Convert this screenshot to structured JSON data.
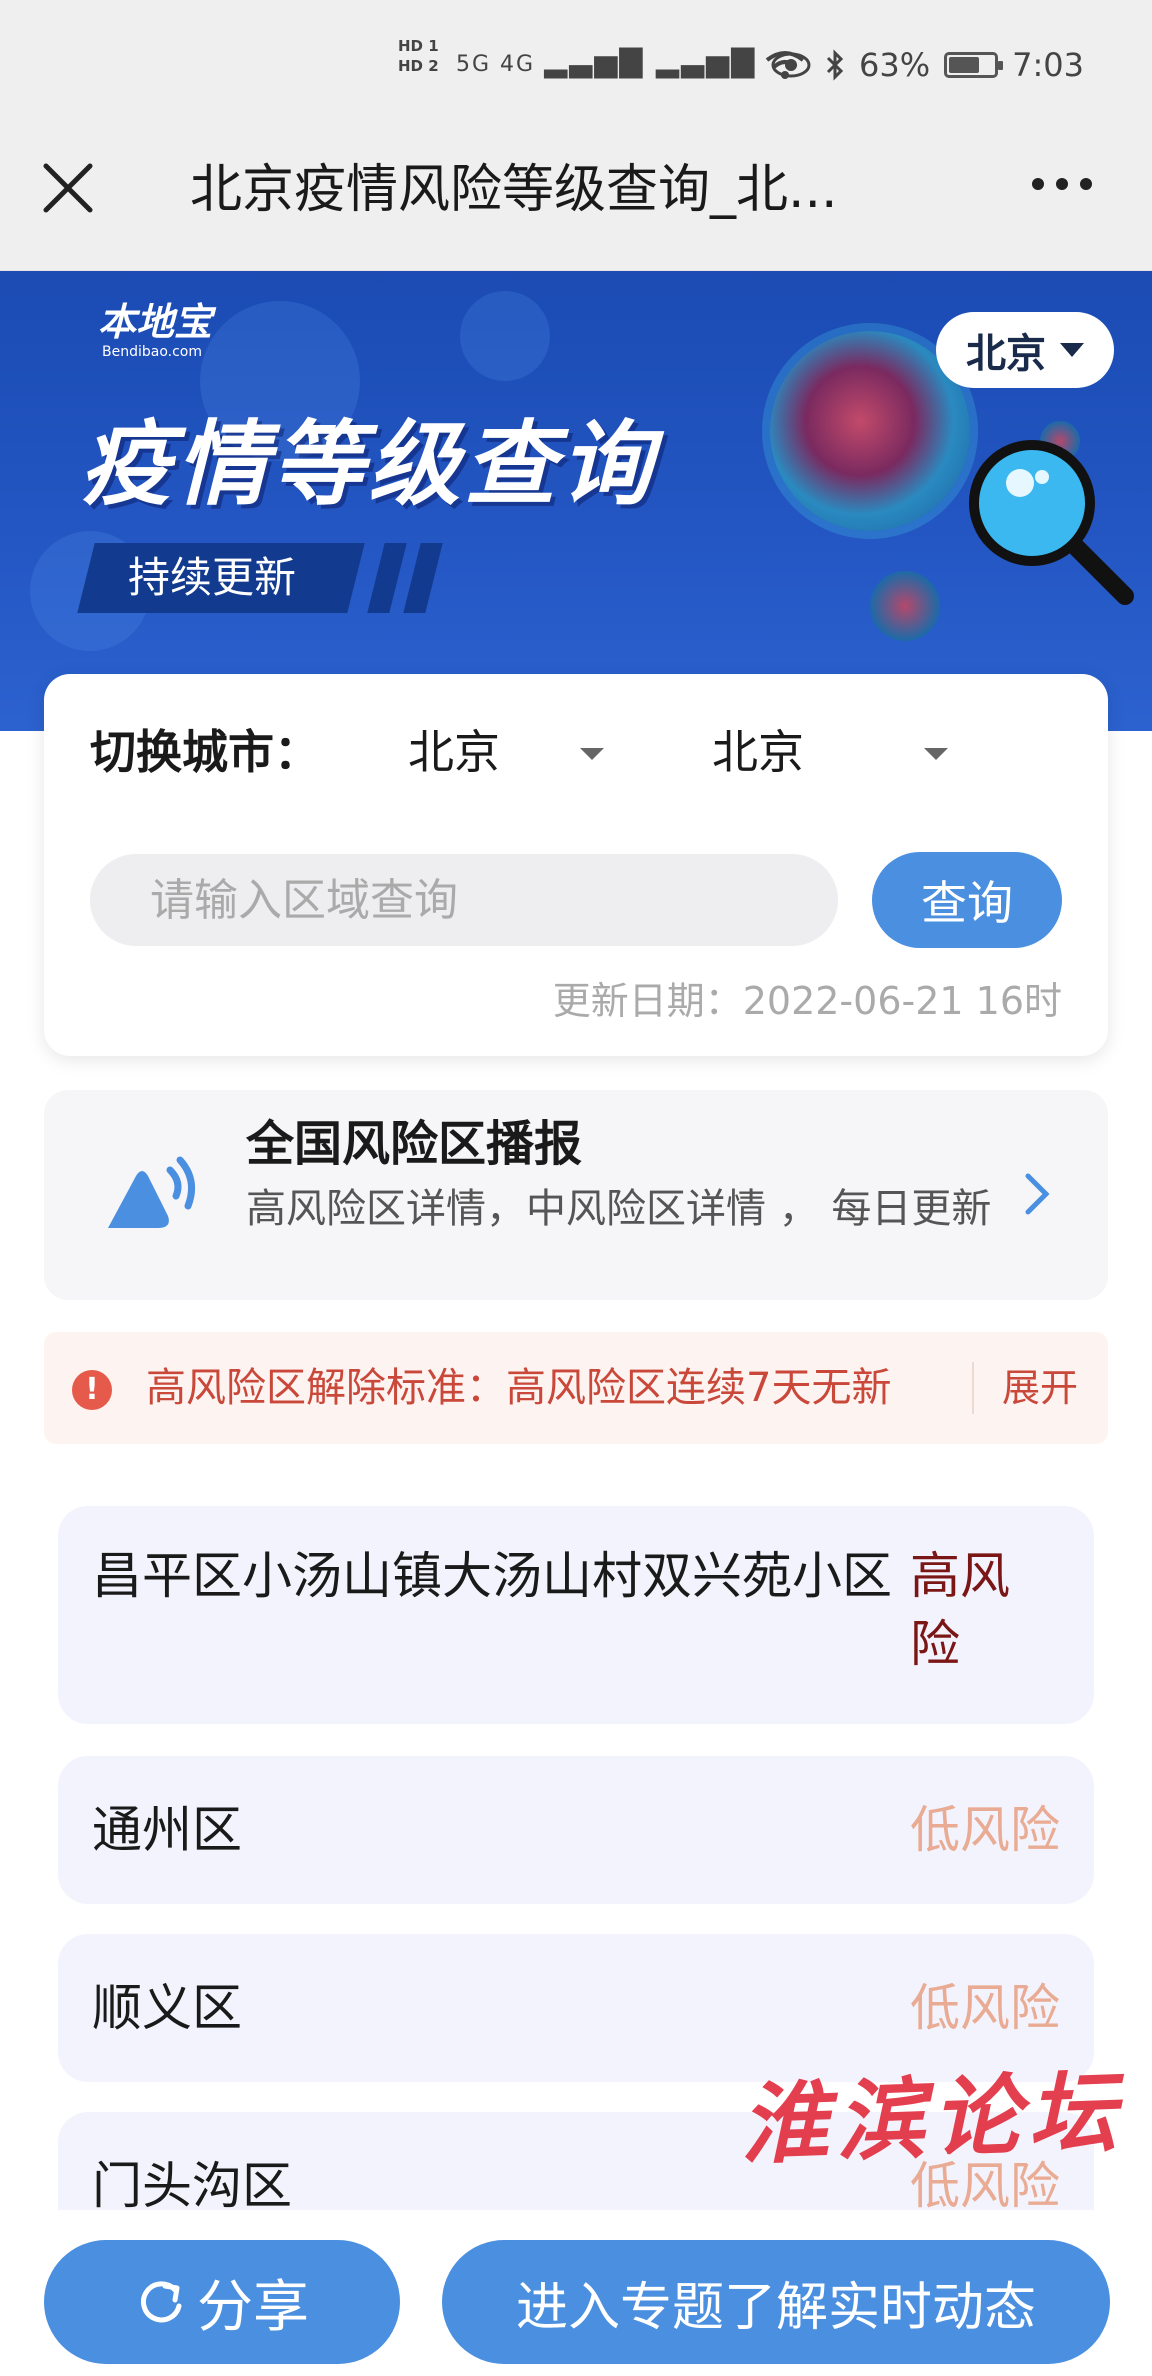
{
  "status_bar": {
    "sim1": "HD 1",
    "sim2": "HD 2",
    "network": "5G 4G",
    "battery": "63%",
    "battery_level": 0.63,
    "time": "7:03"
  },
  "title_bar": {
    "title": "北京疫情风险等级查询_北..."
  },
  "banner": {
    "logo": "本地宝",
    "logo_sub": "Bendibao.com",
    "title": "疫情等级查询",
    "tag": "持续更新",
    "city": "北京"
  },
  "search": {
    "switch_label": "切换城市：",
    "province": "北京",
    "city": "北京",
    "placeholder": "请输入区域查询",
    "button": "查询",
    "update_date": "更新日期：2022-06-21 16时"
  },
  "broadcast": {
    "title": "全国风险区播报",
    "desc": "高风险区详情，中风险区详情 ， 每日更新"
  },
  "notice": {
    "text": "高风险区解除标准：高风险区连续7天无新",
    "expand": "展开"
  },
  "areas": [
    {
      "name": "昌平区小汤山镇大汤山村双兴苑小区",
      "level": "高风险"
    },
    {
      "name": "通州区",
      "level": "低风险"
    },
    {
      "name": "顺义区",
      "level": "低风险"
    },
    {
      "name": "门头沟区",
      "level": "低风险"
    }
  ],
  "watermark": "淮滨论坛",
  "bottom": {
    "share": "分享",
    "topic": "进入专题了解实时动态"
  },
  "colors": {
    "primary": "#4a8fe0",
    "banner": "#2457c4",
    "high_risk": "#7a1616",
    "low_risk": "#e9ab93",
    "notice": "#c9483a"
  }
}
